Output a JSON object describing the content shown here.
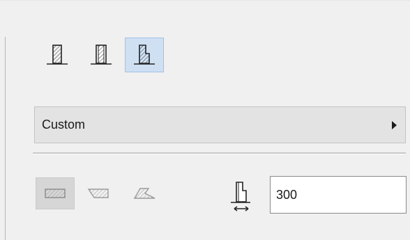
{
  "wall_structure": {
    "options": [
      {
        "icon": "wall-basic-icon",
        "selected": false
      },
      {
        "icon": "wall-composite-icon",
        "selected": false
      },
      {
        "icon": "wall-profile-icon",
        "selected": true
      }
    ]
  },
  "profile_dropdown": {
    "value": "Custom",
    "arrow_icon": "chevron-right-icon"
  },
  "profile_shapes": {
    "options": [
      {
        "icon": "straight-wall-icon",
        "selected": true
      },
      {
        "icon": "slanted-wall-icon",
        "selected": false
      },
      {
        "icon": "double-slanted-wall-icon",
        "selected": false
      }
    ]
  },
  "height": {
    "icon": "wall-height-icon",
    "value": "300"
  },
  "colors": {
    "selected_bg": "#cfe0f3",
    "selected_border": "#9fc2e7",
    "panel_bg": "#f0f0f0"
  }
}
